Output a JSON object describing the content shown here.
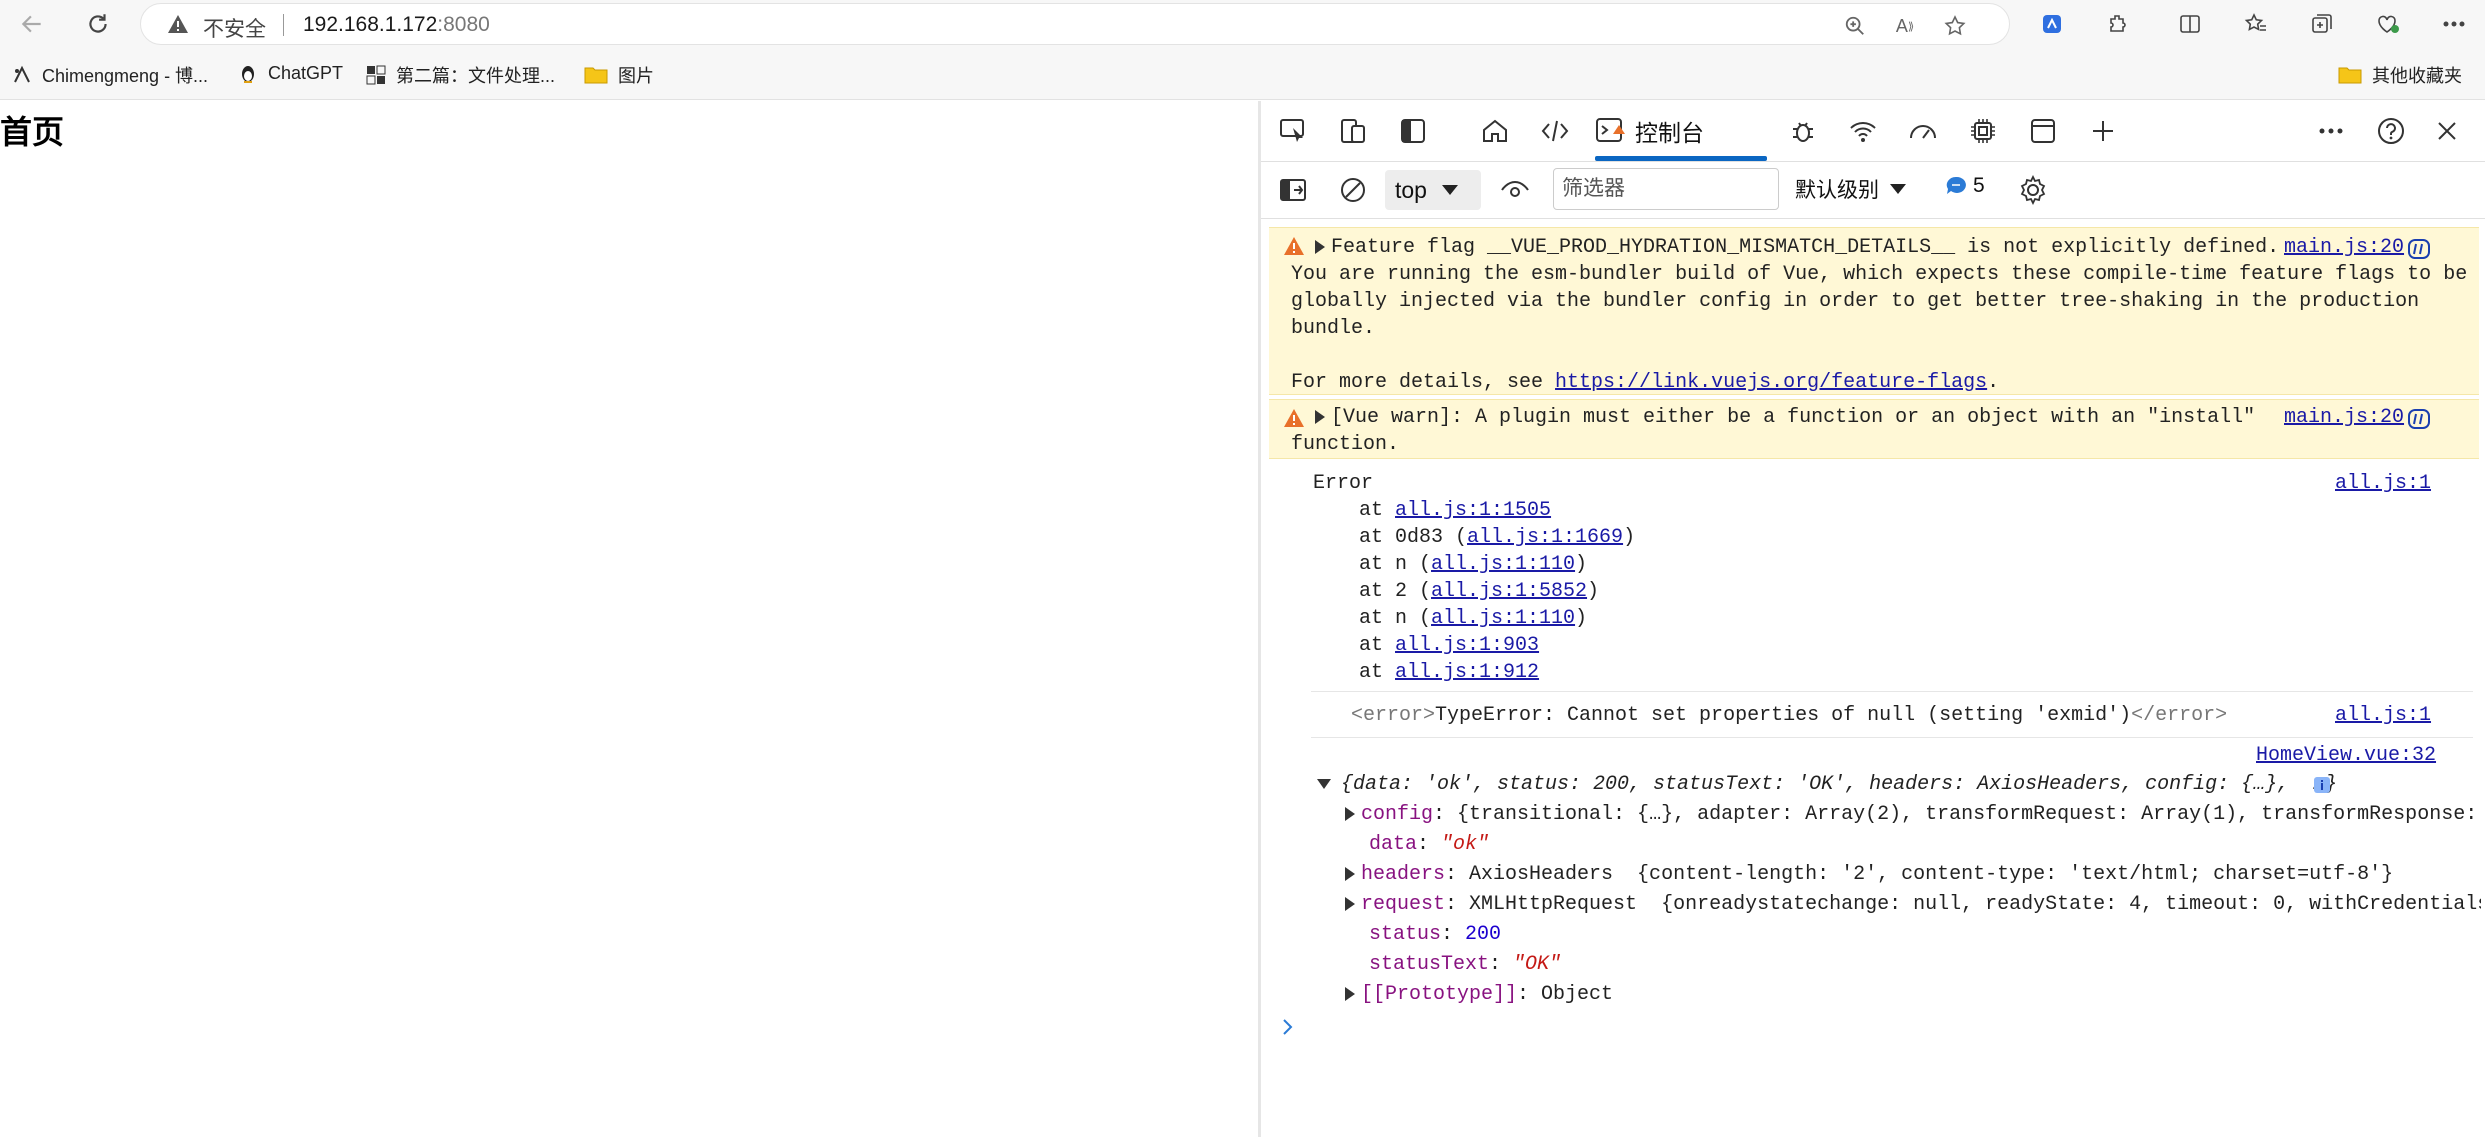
{
  "browser": {
    "security_label": "不安全",
    "url_host": "192.168.1.172",
    "url_port": ":8080",
    "bookmarks": [
      {
        "label": "Chimengmeng - 博...",
        "icon": "blog-icon"
      },
      {
        "label": "ChatGPT",
        "icon": "penguin-icon"
      },
      {
        "label": "第二篇：文件处理...",
        "icon": "site-icon"
      },
      {
        "label": "图片",
        "icon": "folder-icon"
      }
    ],
    "other_bookmarks": "其他收藏夹"
  },
  "page": {
    "heading": "首页"
  },
  "devtools": {
    "console_tab": "控制台",
    "context": "top",
    "filter_placeholder": "筛选器",
    "level": "默认级别",
    "message_count": "5",
    "messages": {
      "warn1": {
        "line1": "Feature flag __VUE_PROD_HYDRATION_MISMATCH_DETAILS__ is not explicitly defined.",
        "line2": "You are running the esm-bundler build of Vue, which expects these compile-time feature flags to be",
        "line3": "globally injected via the bundler config in order to get better tree-shaking in the production",
        "line4": "bundle.",
        "line5_prefix": "For more details, see ",
        "line5_link": "https://link.vuejs.org/feature-flags",
        "line5_suffix": ".",
        "source": "main.js:20"
      },
      "warn2": {
        "line1": "[Vue warn]: A plugin must either be a function or an object with an \"install\"",
        "line2": "function.",
        "source": "main.js:20"
      },
      "error_stack": {
        "title": "Error",
        "source": "all.js:1",
        "frames": [
          {
            "prefix": "at ",
            "link": "all.js:1:1505",
            "suffix": ""
          },
          {
            "prefix": "at 0d83 (",
            "link": "all.js:1:1669",
            "suffix": ")"
          },
          {
            "prefix": "at n (",
            "link": "all.js:1:110",
            "suffix": ")"
          },
          {
            "prefix": "at 2 (",
            "link": "all.js:1:5852",
            "suffix": ")"
          },
          {
            "prefix": "at n (",
            "link": "all.js:1:110",
            "suffix": ")"
          },
          {
            "prefix": "at ",
            "link": "all.js:1:903",
            "suffix": ""
          },
          {
            "prefix": "at ",
            "link": "all.js:1:912",
            "suffix": ""
          }
        ]
      },
      "type_error": {
        "open_tag": "<error>",
        "text": "TypeError: Cannot set properties of null (setting 'exmid')",
        "close_tag": "</error>",
        "source": "all.js:1"
      },
      "log_object": {
        "source": "HomeView.vue:32",
        "summary": "{data: 'ok', status: 200, statusText: 'OK', headers: AxiosHeaders, config: {…},  …}",
        "props": [
          {
            "key": "config",
            "value": "{transitional: {…}, adapter: Array(2), transformRequest: Array(1), transformResponse:",
            "expandable": true
          },
          {
            "key": "data",
            "value": "\"ok\"",
            "expandable": false
          },
          {
            "key": "headers",
            "value": "AxiosHeaders  {content-length: '2', content-type: 'text/html; charset=utf-8'}",
            "expandable": true
          },
          {
            "key": "request",
            "value": "XMLHttpRequest  {onreadystatechange: null, readyState: 4, timeout: 0, withCredentials:",
            "expandable": true
          },
          {
            "key": "status",
            "value": "200",
            "expandable": false
          },
          {
            "key": "statusText",
            "value": "\"OK\"",
            "expandable": false
          },
          {
            "key": "[[Prototype]]",
            "value": "Object",
            "expandable": true
          }
        ]
      }
    }
  },
  "colors": {
    "accent": "#0a66c2",
    "warn_bg": "#fff8d6",
    "warn_icon": "#e8702a",
    "link": "#1a1aa6"
  }
}
